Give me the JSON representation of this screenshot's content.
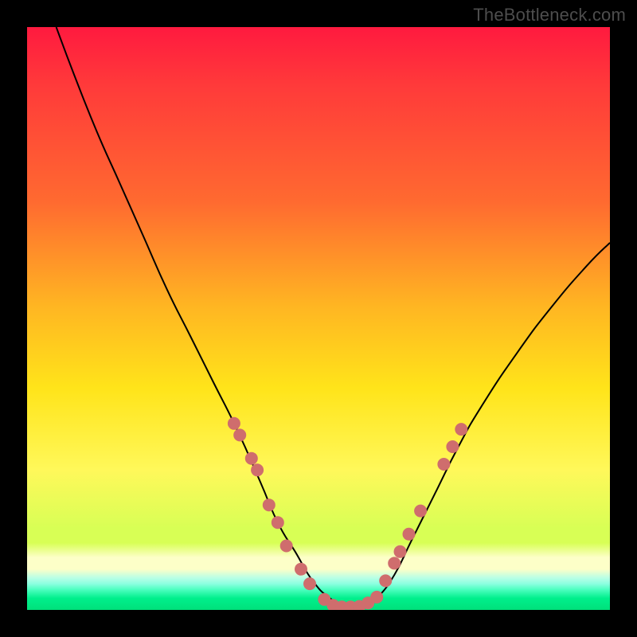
{
  "watermark": "TheBottleneck.com",
  "colors": {
    "background": "#000000",
    "dot_fill": "#cf6d6d",
    "curve_stroke": "#000000"
  },
  "chart_data": {
    "type": "line",
    "title": "",
    "xlabel": "",
    "ylabel": "",
    "xlim": [
      0,
      100
    ],
    "ylim": [
      0,
      100
    ],
    "series": [
      {
        "name": "bottleneck-curve",
        "x": [
          5,
          8,
          12,
          16,
          20,
          24,
          28,
          32,
          36,
          40,
          43,
          46,
          49,
          52,
          55,
          58,
          60,
          63,
          66,
          70,
          74,
          78,
          84,
          90,
          96,
          100
        ],
        "y": [
          100,
          92,
          82,
          73,
          64,
          55,
          47,
          39,
          31,
          22,
          15,
          10,
          5,
          2,
          0.5,
          0.5,
          2,
          6,
          12,
          20,
          28,
          35,
          44,
          52,
          59,
          63
        ]
      }
    ],
    "markers": {
      "name": "sample-dots",
      "points": [
        {
          "x": 35.5,
          "y": 32
        },
        {
          "x": 36.5,
          "y": 30
        },
        {
          "x": 38.5,
          "y": 26
        },
        {
          "x": 39.5,
          "y": 24
        },
        {
          "x": 41.5,
          "y": 18
        },
        {
          "x": 43.0,
          "y": 15
        },
        {
          "x": 44.5,
          "y": 11
        },
        {
          "x": 47.0,
          "y": 7
        },
        {
          "x": 48.5,
          "y": 4.5
        },
        {
          "x": 51.0,
          "y": 1.8
        },
        {
          "x": 52.5,
          "y": 0.8
        },
        {
          "x": 54.0,
          "y": 0.5
        },
        {
          "x": 55.5,
          "y": 0.5
        },
        {
          "x": 57.0,
          "y": 0.6
        },
        {
          "x": 58.5,
          "y": 1.2
        },
        {
          "x": 60.0,
          "y": 2.2
        },
        {
          "x": 61.5,
          "y": 5
        },
        {
          "x": 63.0,
          "y": 8
        },
        {
          "x": 64.0,
          "y": 10
        },
        {
          "x": 65.5,
          "y": 13
        },
        {
          "x": 67.5,
          "y": 17
        },
        {
          "x": 71.5,
          "y": 25
        },
        {
          "x": 73.0,
          "y": 28
        },
        {
          "x": 74.5,
          "y": 31
        }
      ]
    }
  }
}
